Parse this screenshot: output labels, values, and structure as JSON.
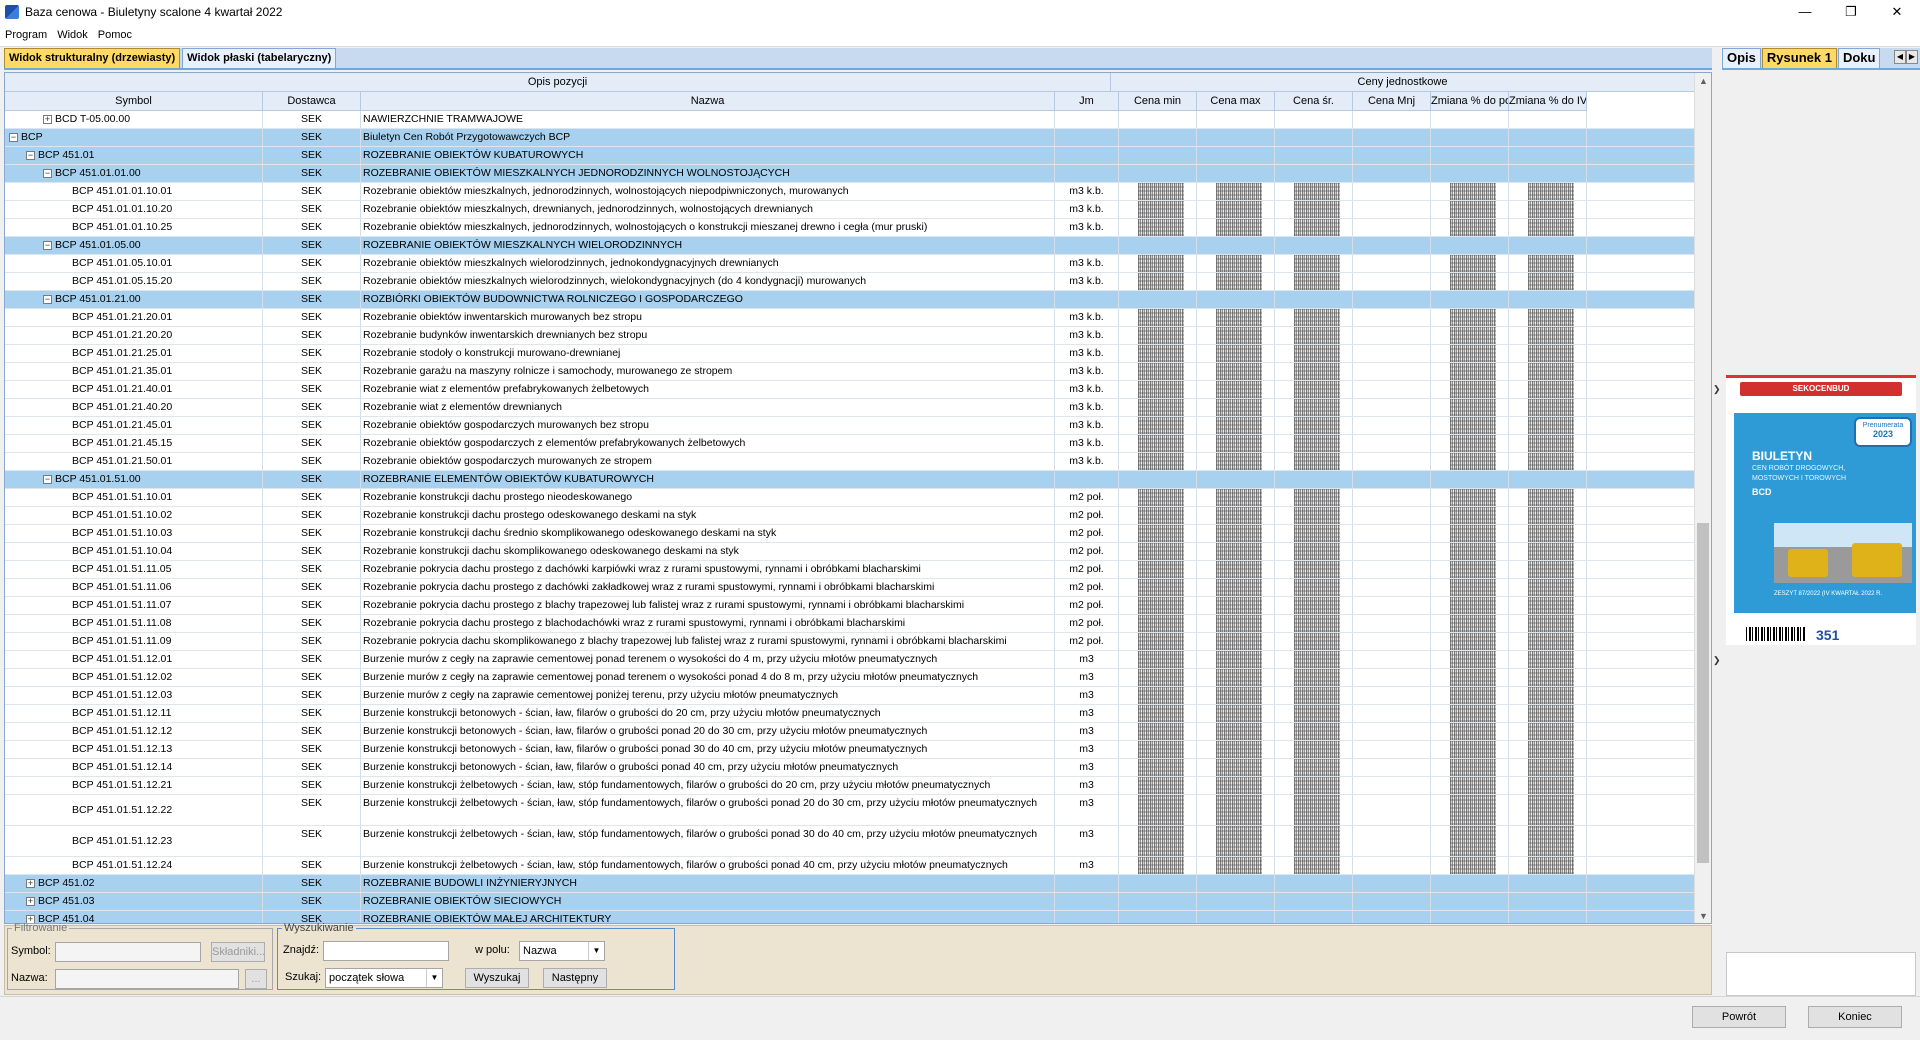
{
  "window": {
    "title": "Baza cenowa - Biuletyny scalone 4 kwartał 2022"
  },
  "menu": [
    "Program",
    "Widok",
    "Pomoc"
  ],
  "tabs": [
    {
      "label": "Widok strukturalny (drzewiasty)",
      "active": true
    },
    {
      "label": "Widok płaski (tabelaryczny)",
      "active": false
    }
  ],
  "header": {
    "group_opis": "Opis pozycji",
    "group_ceny": "Ceny jednostkowe",
    "columns": [
      "Symbol",
      "Dostawca",
      "Nazwa",
      "Jm",
      "Cena min",
      "Cena max",
      "Cena śr.",
      "Cena Mnj",
      "Zmiana % do po...",
      "Zmiana % do IV ..."
    ]
  },
  "rows": [
    {
      "level": 2,
      "exp": "+",
      "grp": false,
      "symbol": "BCD T-05.00.00",
      "dost": "SEK",
      "nazwa": "NAWIERZCHNIE TRAMWAJOWE",
      "jm": ""
    },
    {
      "level": 0,
      "exp": "-",
      "grp": true,
      "symbol": "BCP",
      "dost": "SEK",
      "nazwa": "Biuletyn Cen Robót Przygotowawczych BCP",
      "jm": ""
    },
    {
      "level": 1,
      "exp": "-",
      "grp": true,
      "symbol": "BCP 451.01",
      "dost": "SEK",
      "nazwa": "ROZEBRANIE OBIEKTÓW KUBATUROWYCH",
      "jm": ""
    },
    {
      "level": 2,
      "exp": "-",
      "grp": true,
      "symbol": "BCP 451.01.01.00",
      "dost": "SEK",
      "nazwa": "ROZEBRANIE OBIEKTÓW MIESZKALNYCH JEDNORODZINNYCH WOLNOSTOJĄCYCH",
      "jm": ""
    },
    {
      "level": 3,
      "exp": "",
      "grp": false,
      "symbol": "BCP 451.01.01.10.01",
      "dost": "SEK",
      "nazwa": "Rozebranie obiektów mieszkalnych, jednorodzinnych, wolnostojących niepodpiwniczonych, murowanych",
      "jm": "m3 k.b."
    },
    {
      "level": 3,
      "exp": "",
      "grp": false,
      "symbol": "BCP 451.01.01.10.20",
      "dost": "SEK",
      "nazwa": "Rozebranie obiektów mieszkalnych, drewnianych, jednorodzinnych, wolnostojących drewnianych",
      "jm": "m3 k.b."
    },
    {
      "level": 3,
      "exp": "",
      "grp": false,
      "symbol": "BCP 451.01.01.10.25",
      "dost": "SEK",
      "nazwa": "Rozebranie obiektów mieszkalnych, jednorodzinnych, wolnostojących o konstrukcji mieszanej drewno i cegła (mur pruski)",
      "jm": "m3 k.b."
    },
    {
      "level": 2,
      "exp": "-",
      "grp": true,
      "symbol": "BCP 451.01.05.00",
      "dost": "SEK",
      "nazwa": "ROZEBRANIE OBIEKTÓW MIESZKALNYCH WIELORODZINNYCH",
      "jm": ""
    },
    {
      "level": 3,
      "exp": "",
      "grp": false,
      "symbol": "BCP 451.01.05.10.01",
      "dost": "SEK",
      "nazwa": "Rozebranie obiektów mieszkalnych wielorodzinnych, jednokondygnacyjnych drewnianych",
      "jm": "m3 k.b."
    },
    {
      "level": 3,
      "exp": "",
      "grp": false,
      "symbol": "BCP 451.01.05.15.20",
      "dost": "SEK",
      "nazwa": "Rozebranie obiektów mieszkalnych wielorodzinnych, wielokondygnacyjnych (do 4 kondygnacji) murowanych",
      "jm": "m3 k.b."
    },
    {
      "level": 2,
      "exp": "-",
      "grp": true,
      "symbol": "BCP 451.01.21.00",
      "dost": "SEK",
      "nazwa": "ROZBIÓRKI OBIEKTÓW BUDOWNICTWA ROLNICZEGO I GOSPODARCZEGO",
      "jm": ""
    },
    {
      "level": 3,
      "exp": "",
      "grp": false,
      "symbol": "BCP 451.01.21.20.01",
      "dost": "SEK",
      "nazwa": "Rozebranie obiektów inwentarskich murowanych bez stropu",
      "jm": "m3 k.b."
    },
    {
      "level": 3,
      "exp": "",
      "grp": false,
      "symbol": "BCP 451.01.21.20.20",
      "dost": "SEK",
      "nazwa": "Rozebranie budynków inwentarskich drewnianych bez stropu",
      "jm": "m3 k.b."
    },
    {
      "level": 3,
      "exp": "",
      "grp": false,
      "symbol": "BCP 451.01.21.25.01",
      "dost": "SEK",
      "nazwa": "Rozebranie stodoły o konstrukcji murowano-drewnianej",
      "jm": "m3 k.b."
    },
    {
      "level": 3,
      "exp": "",
      "grp": false,
      "symbol": "BCP 451.01.21.35.01",
      "dost": "SEK",
      "nazwa": "Rozebranie garażu na maszyny rolnicze i samochody, murowanego ze stropem",
      "jm": "m3 k.b."
    },
    {
      "level": 3,
      "exp": "",
      "grp": false,
      "symbol": "BCP 451.01.21.40.01",
      "dost": "SEK",
      "nazwa": "Rozebranie wiat z elementów prefabrykowanych żelbetowych",
      "jm": "m3 k.b."
    },
    {
      "level": 3,
      "exp": "",
      "grp": false,
      "symbol": "BCP 451.01.21.40.20",
      "dost": "SEK",
      "nazwa": "Rozebranie wiat z elementów drewnianych",
      "jm": "m3 k.b."
    },
    {
      "level": 3,
      "exp": "",
      "grp": false,
      "symbol": "BCP 451.01.21.45.01",
      "dost": "SEK",
      "nazwa": "Rozebranie obiektów gospodarczych murowanych bez stropu",
      "jm": "m3 k.b."
    },
    {
      "level": 3,
      "exp": "",
      "grp": false,
      "symbol": "BCP 451.01.21.45.15",
      "dost": "SEK",
      "nazwa": "Rozebranie obiektów gospodarczych z elementów prefabrykowanych żelbetowych",
      "jm": "m3 k.b."
    },
    {
      "level": 3,
      "exp": "",
      "grp": false,
      "symbol": "BCP 451.01.21.50.01",
      "dost": "SEK",
      "nazwa": "Rozebranie obiektów gospodarczych murowanych ze stropem",
      "jm": "m3 k.b."
    },
    {
      "level": 2,
      "exp": "-",
      "grp": true,
      "symbol": "BCP 451.01.51.00",
      "dost": "SEK",
      "nazwa": "ROZEBRANIE ELEMENTÓW OBIEKTÓW KUBATUROWYCH",
      "jm": ""
    },
    {
      "level": 3,
      "exp": "",
      "grp": false,
      "symbol": "BCP 451.01.51.10.01",
      "dost": "SEK",
      "nazwa": "Rozebranie konstrukcji dachu prostego nieodeskowanego",
      "jm": "m2 poł."
    },
    {
      "level": 3,
      "exp": "",
      "grp": false,
      "symbol": "BCP 451.01.51.10.02",
      "dost": "SEK",
      "nazwa": "Rozebranie konstrukcji dachu prostego odeskowanego deskami na styk",
      "jm": "m2 poł."
    },
    {
      "level": 3,
      "exp": "",
      "grp": false,
      "symbol": "BCP 451.01.51.10.03",
      "dost": "SEK",
      "nazwa": "Rozebranie konstrukcji dachu średnio skomplikowanego odeskowanego deskami na styk",
      "jm": "m2 poł."
    },
    {
      "level": 3,
      "exp": "",
      "grp": false,
      "symbol": "BCP 451.01.51.10.04",
      "dost": "SEK",
      "nazwa": "Rozebranie konstrukcji dachu skomplikowanego odeskowanego deskami na styk",
      "jm": "m2 poł."
    },
    {
      "level": 3,
      "exp": "",
      "grp": false,
      "symbol": "BCP 451.01.51.11.05",
      "dost": "SEK",
      "nazwa": "Rozebranie pokrycia dachu prostego z dachówki karpiówki wraz z rurami spustowymi, rynnami i obróbkami blacharskimi",
      "jm": "m2 poł."
    },
    {
      "level": 3,
      "exp": "",
      "grp": false,
      "symbol": "BCP 451.01.51.11.06",
      "dost": "SEK",
      "nazwa": "Rozebranie pokrycia dachu prostego z dachówki zakładkowej wraz z rurami spustowymi, rynnami i obróbkami blacharskimi",
      "jm": "m2 poł."
    },
    {
      "level": 3,
      "exp": "",
      "grp": false,
      "symbol": "BCP 451.01.51.11.07",
      "dost": "SEK",
      "nazwa": "Rozebranie pokrycia dachu prostego z blachy trapezowej lub falistej wraz z rurami spustowymi, rynnami i obróbkami blacharskimi",
      "jm": "m2 poł."
    },
    {
      "level": 3,
      "exp": "",
      "grp": false,
      "symbol": "BCP 451.01.51.11.08",
      "dost": "SEK",
      "nazwa": "Rozebranie pokrycia dachu prostego z blachodachówki wraz z rurami spustowymi, rynnami i obróbkami blacharskimi",
      "jm": "m2 poł."
    },
    {
      "level": 3,
      "exp": "",
      "grp": false,
      "symbol": "BCP 451.01.51.11.09",
      "dost": "SEK",
      "nazwa": "Rozebranie pokrycia dachu skomplikowanego z blachy trapezowej lub falistej wraz z rurami spustowymi, rynnami i obróbkami blacharskimi",
      "jm": "m2 poł."
    },
    {
      "level": 3,
      "exp": "",
      "grp": false,
      "symbol": "BCP 451.01.51.12.01",
      "dost": "SEK",
      "nazwa": "Burzenie murów z cegły na zaprawie cementowej ponad terenem o wysokości do 4 m, przy użyciu młotów pneumatycznych",
      "jm": "m3"
    },
    {
      "level": 3,
      "exp": "",
      "grp": false,
      "symbol": "BCP 451.01.51.12.02",
      "dost": "SEK",
      "nazwa": "Burzenie murów z cegły na zaprawie cementowej ponad terenem o wysokości ponad 4 do 8 m, przy użyciu młotów pneumatycznych",
      "jm": "m3"
    },
    {
      "level": 3,
      "exp": "",
      "grp": false,
      "symbol": "BCP 451.01.51.12.03",
      "dost": "SEK",
      "nazwa": "Burzenie murów z cegły na zaprawie cementowej poniżej terenu, przy użyciu młotów pneumatycznych",
      "jm": "m3"
    },
    {
      "level": 3,
      "exp": "",
      "grp": false,
      "symbol": "BCP 451.01.51.12.11",
      "dost": "SEK",
      "nazwa": "Burzenie konstrukcji betonowych - ścian, ław, filarów o grubości do 20 cm, przy użyciu młotów pneumatycznych",
      "jm": "m3"
    },
    {
      "level": 3,
      "exp": "",
      "grp": false,
      "symbol": "BCP 451.01.51.12.12",
      "dost": "SEK",
      "nazwa": "Burzenie konstrukcji betonowych - ścian, ław, filarów o grubości ponad 20 do 30 cm, przy użyciu młotów pneumatycznych",
      "jm": "m3"
    },
    {
      "level": 3,
      "exp": "",
      "grp": false,
      "symbol": "BCP 451.01.51.12.13",
      "dost": "SEK",
      "nazwa": "Burzenie konstrukcji betonowych - ścian, ław, filarów o grubości ponad 30 do 40 cm, przy użyciu młotów pneumatycznych",
      "jm": "m3"
    },
    {
      "level": 3,
      "exp": "",
      "grp": false,
      "symbol": "BCP 451.01.51.12.14",
      "dost": "SEK",
      "nazwa": "Burzenie konstrukcji betonowych - ścian, ław, filarów o grubości ponad 40 cm, przy użyciu młotów pneumatycznych",
      "jm": "m3"
    },
    {
      "level": 3,
      "exp": "",
      "grp": false,
      "symbol": "BCP 451.01.51.12.21",
      "dost": "SEK",
      "nazwa": "Burzenie konstrukcji żelbetowych - ścian, ław, stóp fundamentowych, filarów o grubości do 20 cm, przy użyciu młotów pneumatycznych",
      "jm": "m3"
    },
    {
      "level": 3,
      "exp": "",
      "grp": false,
      "tall": true,
      "symbol": "BCP 451.01.51.12.22",
      "dost": "SEK",
      "nazwa": "Burzenie konstrukcji żelbetowych - ścian, ław, stóp fundamentowych, filarów o grubości ponad 20 do 30 cm, przy użyciu młotów pneumatycznych",
      "jm": "m3"
    },
    {
      "level": 3,
      "exp": "",
      "grp": false,
      "tall": true,
      "symbol": "BCP 451.01.51.12.23",
      "dost": "SEK",
      "nazwa": "Burzenie konstrukcji żelbetowych - ścian, ław, stóp fundamentowych, filarów o grubości ponad 30 do 40 cm, przy użyciu młotów pneumatycznych",
      "jm": "m3"
    },
    {
      "level": 3,
      "exp": "",
      "grp": false,
      "symbol": "BCP 451.01.51.12.24",
      "dost": "SEK",
      "nazwa": "Burzenie konstrukcji żelbetowych - ścian, ław, stóp fundamentowych, filarów o grubości ponad 40 cm, przy użyciu młotów pneumatycznych",
      "jm": "m3"
    },
    {
      "level": 1,
      "exp": "+",
      "grp": true,
      "symbol": "BCP 451.02",
      "dost": "SEK",
      "nazwa": "ROZEBRANIE BUDOWLI INŻYNIERYJNYCH",
      "jm": ""
    },
    {
      "level": 1,
      "exp": "+",
      "grp": true,
      "symbol": "BCP 451.03",
      "dost": "SEK",
      "nazwa": "ROZEBRANIE OBIEKTÓW SIECIOWYCH",
      "jm": ""
    },
    {
      "level": 1,
      "exp": "+",
      "grp": true,
      "symbol": "BCP 451.04",
      "dost": "SEK",
      "nazwa": "ROZEBRANIE OBIEKTÓW MAŁEJ ARCHITEKTURY",
      "jm": ""
    }
  ],
  "filter": {
    "legend": "Filtrowanie",
    "symbol_label": "Symbol:",
    "nazwa_label": "Nazwa:",
    "skladniki_btn": "Składniki...",
    "dots_btn": "..."
  },
  "search": {
    "legend": "Wyszukiwanie",
    "znajdz_label": "Znajdź:",
    "wpolu_label": "w polu:",
    "wpolu_value": "Nazwa",
    "szukaj_label": "Szukaj:",
    "szukaj_value": "początek słowa",
    "search_btn": "Wyszukaj",
    "next_btn": "Następny"
  },
  "footer": {
    "back_btn": "Powrót",
    "end_btn": "Koniec"
  },
  "right_panel": {
    "tabs": [
      {
        "label": "Opis",
        "active": false
      },
      {
        "label": "Rysunek 1",
        "active": true
      },
      {
        "label": "Doku",
        "active": false
      }
    ],
    "cover": {
      "brand": "SEKOCENBUD",
      "title": "BIULETYN",
      "subtitle_1": "CEN ROBÓT DROGOWYCH,",
      "subtitle_2": "MOSTOWYCH I TOROWYCH",
      "code": "BCD",
      "footer": "ZESZYT 87/2022 (IV KWARTAŁ 2022 R.",
      "badge_1": "Prenumerata",
      "badge_2": "2023",
      "number": "351"
    }
  }
}
